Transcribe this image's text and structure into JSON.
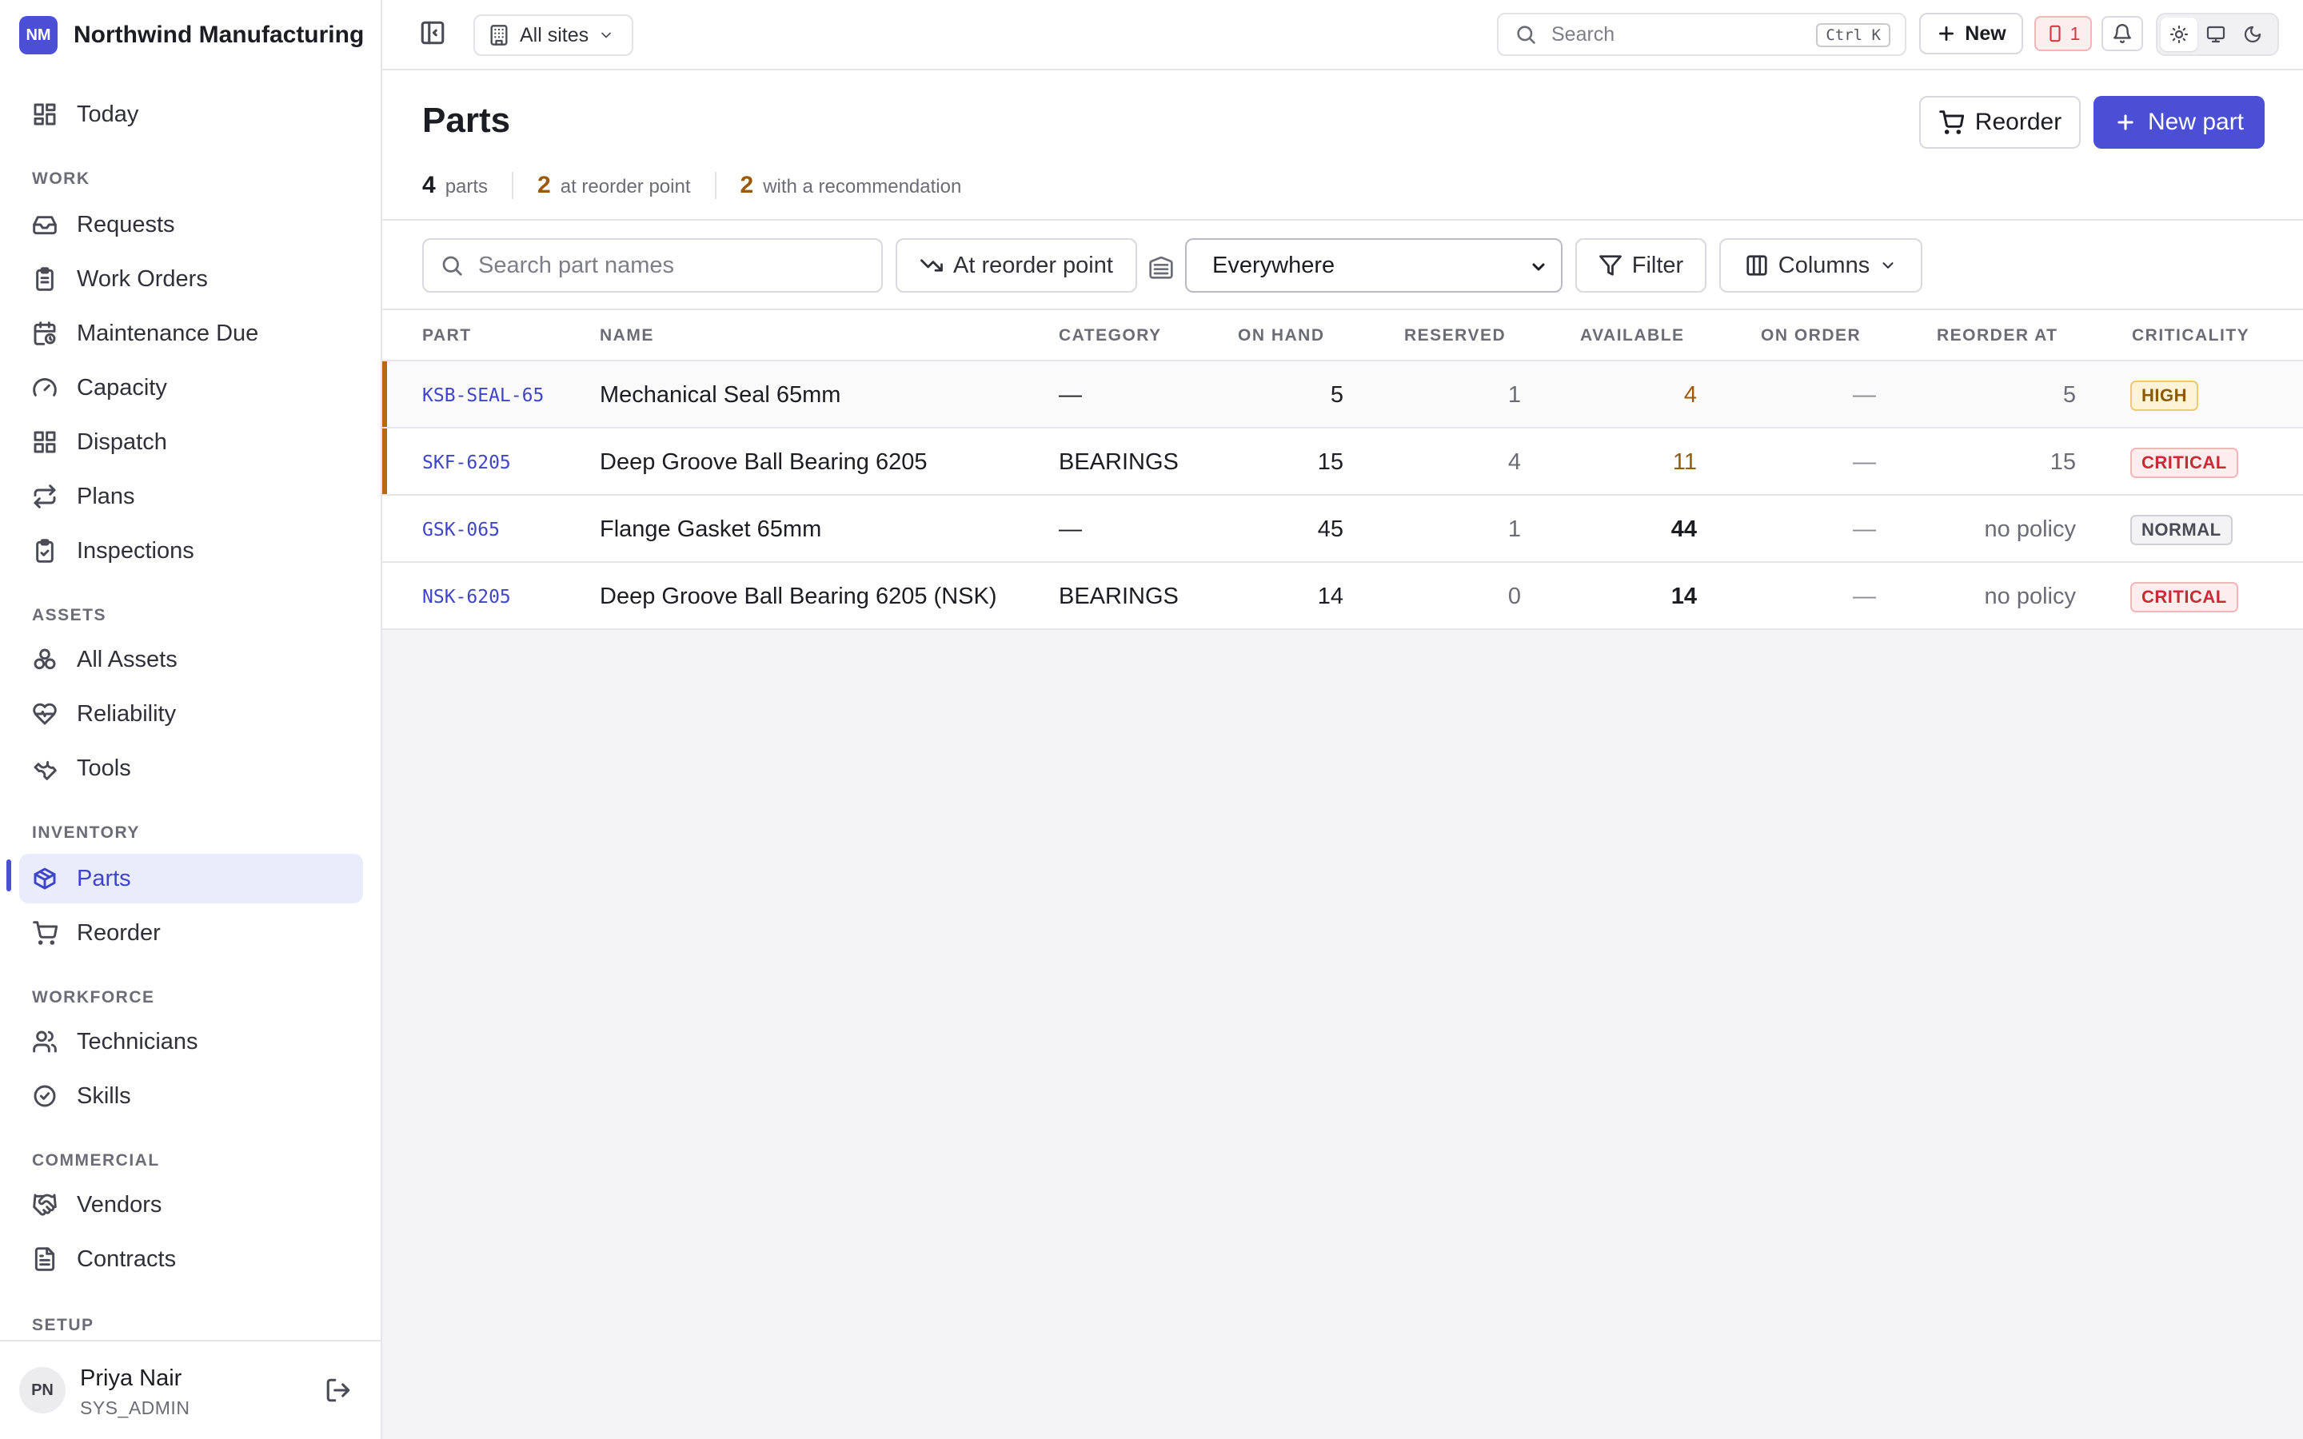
{
  "brand": {
    "initials": "NM",
    "name": "Northwind Manufacturing"
  },
  "sidebar": {
    "today": "Today",
    "sections": {
      "work": "WORK",
      "assets": "ASSETS",
      "inventory": "INVENTORY",
      "workforce": "WORKFORCE",
      "commercial": "COMMERCIAL",
      "setup": "SETUP"
    },
    "items": {
      "requests": "Requests",
      "work_orders": "Work Orders",
      "maintenance_due": "Maintenance Due",
      "capacity": "Capacity",
      "dispatch": "Dispatch",
      "plans": "Plans",
      "inspections": "Inspections",
      "all_assets": "All Assets",
      "reliability": "Reliability",
      "tools": "Tools",
      "parts": "Parts",
      "reorder": "Reorder",
      "technicians": "Technicians",
      "skills": "Skills",
      "vendors": "Vendors",
      "contracts": "Contracts"
    },
    "user": {
      "initials": "PN",
      "name": "Priya Nair",
      "role": "SYS_ADMIN"
    }
  },
  "topbar": {
    "site_selector": "All sites",
    "search_placeholder": "Search",
    "search_shortcut": "Ctrl K",
    "new_label": "New",
    "alert_count": "1"
  },
  "page": {
    "title": "Parts",
    "stats": [
      {
        "value": "4",
        "label": "parts"
      },
      {
        "value": "2",
        "label": "at reorder point"
      },
      {
        "value": "2",
        "label": "with a recommendation"
      }
    ],
    "reorder_label": "Reorder",
    "new_part_label": "New part"
  },
  "toolbar": {
    "search_placeholder": "Search part names",
    "reorder_filter": "At reorder point",
    "location": "Everywhere",
    "filter_label": "Filter",
    "columns_label": "Columns"
  },
  "table": {
    "columns": [
      "PART",
      "NAME",
      "CATEGORY",
      "ON HAND",
      "RESERVED",
      "AVAILABLE",
      "ON ORDER",
      "REORDER AT",
      "CRITICALITY"
    ],
    "rows": [
      {
        "part": "KSB-SEAL-65",
        "name": "Mechanical Seal 65mm",
        "category": "—",
        "on_hand": "5",
        "reserved": "1",
        "available": "4",
        "on_order": "—",
        "reorder_at": "5",
        "criticality": "HIGH"
      },
      {
        "part": "SKF-6205",
        "name": "Deep Groove Ball Bearing 6205",
        "category": "BEARINGS",
        "on_hand": "15",
        "reserved": "4",
        "available": "11",
        "on_order": "—",
        "reorder_at": "15",
        "criticality": "CRITICAL"
      },
      {
        "part": "GSK-065",
        "name": "Flange Gasket 65mm",
        "category": "—",
        "on_hand": "45",
        "reserved": "1",
        "available": "44",
        "on_order": "—",
        "reorder_at": "no policy",
        "criticality": "NORMAL"
      },
      {
        "part": "NSK-6205",
        "name": "Deep Groove Ball Bearing 6205 (NSK)",
        "category": "BEARINGS",
        "on_hand": "14",
        "reserved": "0",
        "available": "14",
        "on_order": "—",
        "reorder_at": "no policy",
        "criticality": "CRITICAL"
      }
    ]
  },
  "colors": {
    "accent": "#4a4fd6",
    "warning": "#9a5a0a",
    "critical": "#c92a36"
  }
}
